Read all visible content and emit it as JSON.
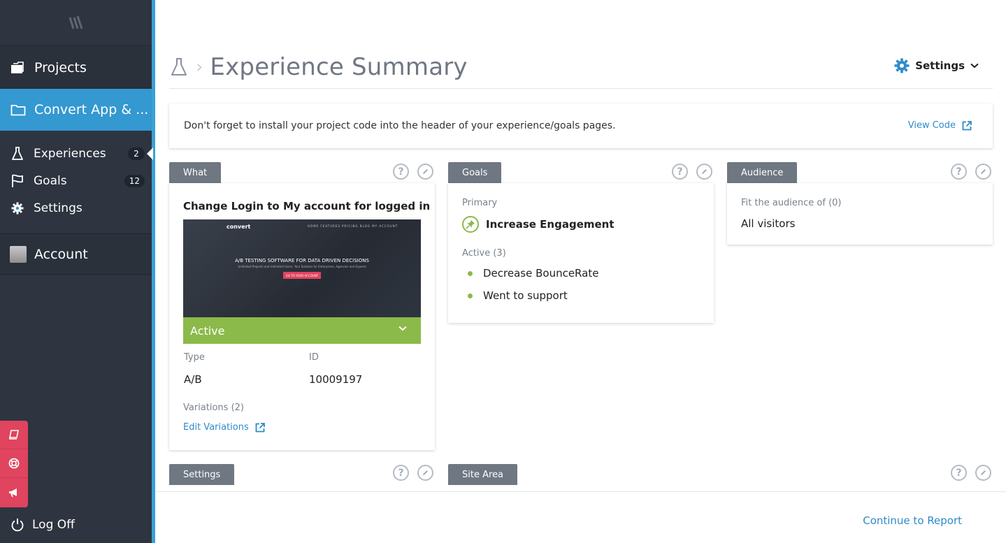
{
  "sidebar": {
    "projects_label": "Projects",
    "project_name": "Convert App & ...",
    "sub_items": [
      {
        "label": "Experiences",
        "badge": "2"
      },
      {
        "label": "Goals",
        "badge": "12"
      },
      {
        "label": "Settings"
      }
    ],
    "account_label": "Account",
    "logoff_label": "Log Off"
  },
  "header": {
    "title": "Experience Summary",
    "settings_label": "Settings"
  },
  "notice": {
    "text": "Don't forget to install your project code into the header of your experience/goals pages.",
    "view_code": "View Code"
  },
  "what": {
    "tab": "What",
    "title": "Change Login to My account for logged in",
    "thumb": {
      "logo": "convert",
      "headline": "A/B TESTING SOFTWARE FOR DATA DRIVEN DECISIONS",
      "nav": "HOME  FEATURES  PRICING  BLOG  MY ACCOUNT",
      "sub": "Unlimited Projects and Unlimited Users. Your Solution for Enterprises, Agencies and Experts",
      "button": "GO TO YOUR ACCOUNT"
    },
    "status": "Active",
    "type_label": "Type",
    "type_value": "A/B",
    "id_label": "ID",
    "id_value": "10009197",
    "variations_label": "Variations (2)",
    "edit_link": "Edit Variations"
  },
  "goals": {
    "tab": "Goals",
    "primary_label": "Primary",
    "primary_goal": "Increase Engagement",
    "active_label": "Active (3)",
    "active_goals": [
      "Decrease BounceRate",
      "Went to support"
    ]
  },
  "audience": {
    "tab": "Audience",
    "fit_label": "Fit the audience of (0)",
    "value": "All visitors"
  },
  "settings_card": {
    "tab": "Settings"
  },
  "site_area_card": {
    "tab": "Site Area"
  },
  "footer": {
    "continue": "Continue to Report"
  },
  "colors": {
    "accent_blue": "#3498d1",
    "active_green": "#8bba4a",
    "help_red": "#e0445e",
    "sidebar_dark": "#2e3440"
  },
  "icons": {
    "tool_help": "?"
  }
}
